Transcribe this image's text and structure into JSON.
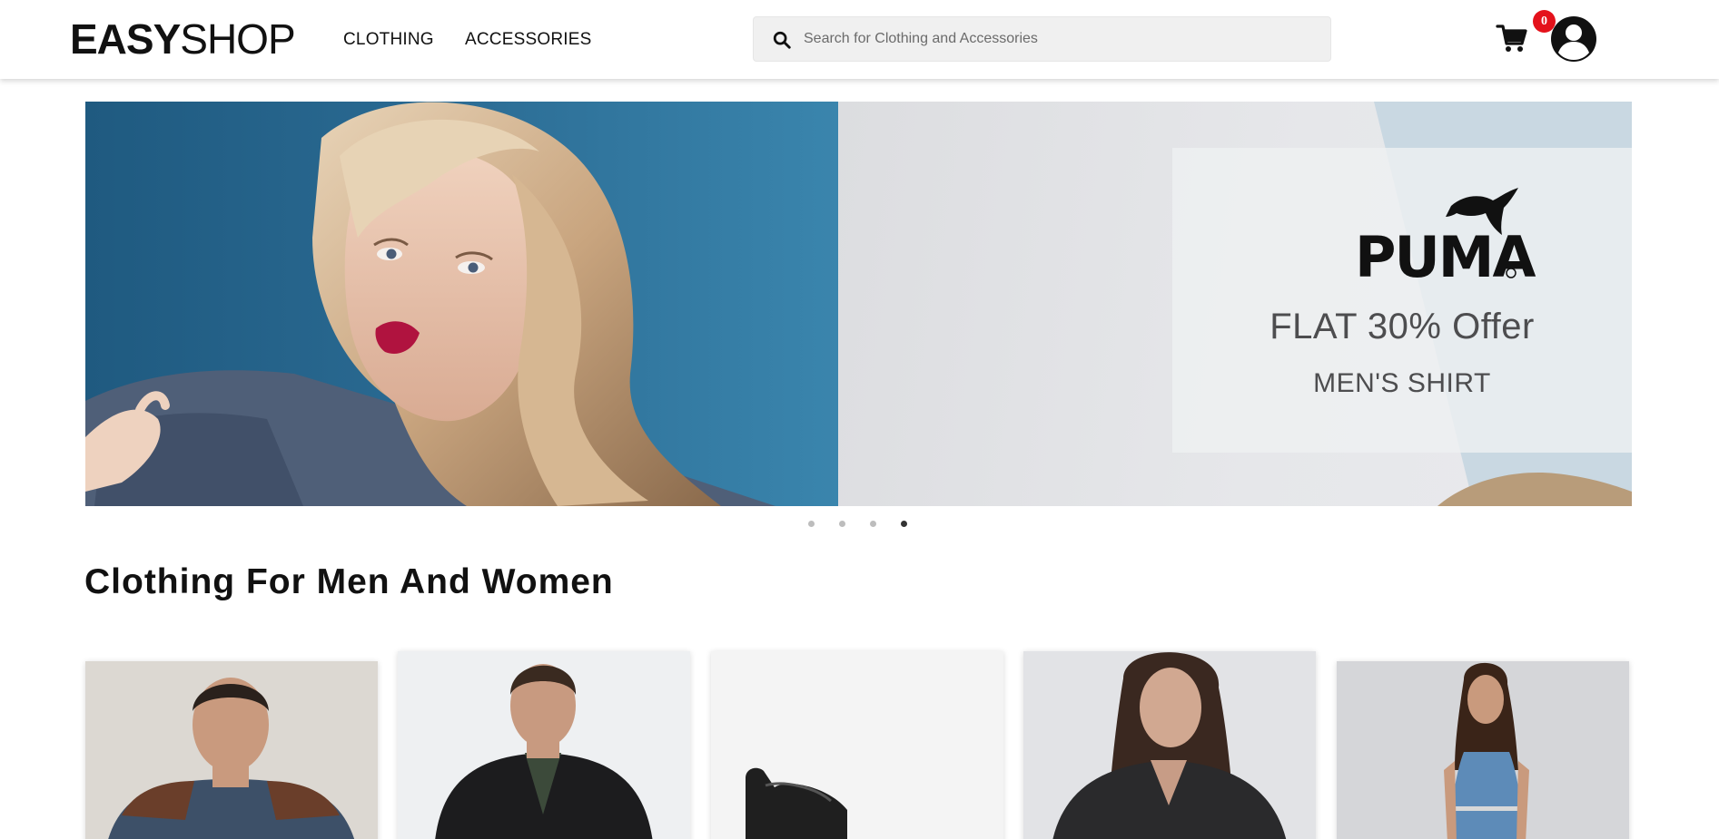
{
  "header": {
    "logo_bold": "EASY",
    "logo_light": "SHOP",
    "nav": [
      {
        "label": "CLOTHING"
      },
      {
        "label": "ACCESSORIES"
      }
    ],
    "search": {
      "placeholder": "Search for Clothing and Accessories",
      "value": ""
    },
    "cart_count": "0",
    "icons": {
      "search": "search-icon",
      "cart": "cart-icon",
      "account": "account-circle-icon"
    }
  },
  "carousel": {
    "brand": "PUMA",
    "headline": "FLAT 30% Offer",
    "subline": "MEN'S SHIRT",
    "slide_count": 4,
    "active_slide": 4
  },
  "section": {
    "title": "Clothing For Men And Women",
    "products": [
      {
        "name": "men-sweater"
      },
      {
        "name": "men-jacket"
      },
      {
        "name": "boots"
      },
      {
        "name": "women-leather-jacket"
      },
      {
        "name": "women-denim-dress"
      }
    ]
  },
  "colors": {
    "badge": "#e4121b",
    "banner_blue": "#2a6a92",
    "search_bg": "#f0f0f0"
  }
}
